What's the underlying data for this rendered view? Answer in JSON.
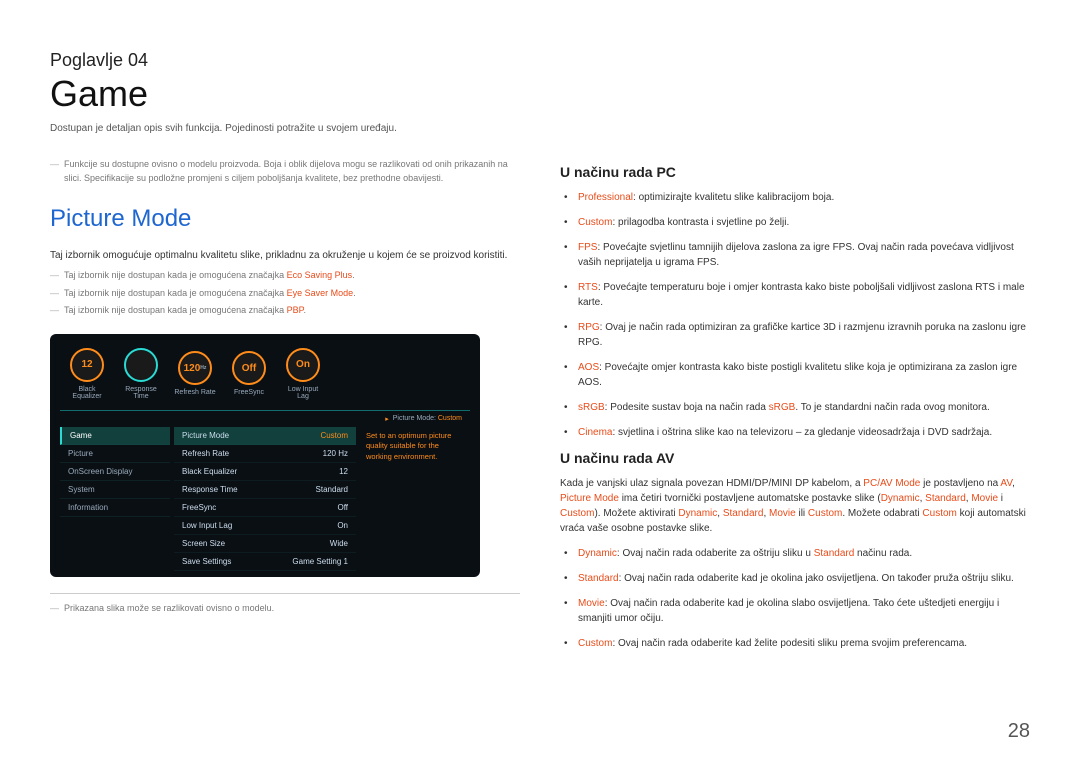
{
  "chapter": {
    "label": "Poglavlje 04",
    "title": "Game",
    "subtitle": "Dostupan je detaljan opis svih funkcija. Pojedinosti potražite u svojem uređaju."
  },
  "left": {
    "disclaimer": "Funkcije su dostupne ovisno o modelu proizvoda. Boja i oblik dijelova mogu se razlikovati od onih prikazanih na slici. Specifikacije su podložne promjeni s ciljem poboljšanja kvalitete, bez prethodne obavijesti.",
    "h2": "Picture Mode",
    "p": "Taj izbornik omogućuje optimalnu kvalitetu slike, prikladnu za okruženje u kojem će se proizvod koristiti.",
    "notes": [
      {
        "pre": "Taj izbornik nije dostupan kada je omogućena značajka ",
        "red": "Eco Saving Plus",
        "post": "."
      },
      {
        "pre": "Taj izbornik nije dostupan kada je omogućena značajka ",
        "red": "Eye Saver Mode",
        "post": "."
      },
      {
        "pre": "Taj izbornik nije dostupan kada je omogućena značajka ",
        "red": "PBP",
        "post": "."
      }
    ],
    "footnote": "Prikazana slika može se razlikovati ovisno o modelu."
  },
  "osd": {
    "dials": [
      {
        "val": "12",
        "lbl": "Black Equalizer",
        "style": "orange"
      },
      {
        "val": "",
        "lbl": "Response Time",
        "style": "cyan"
      },
      {
        "val": "120",
        "sub": "Hz",
        "lbl": "Refresh Rate",
        "style": "orange"
      },
      {
        "val": "Off",
        "lbl": "FreeSync",
        "style": "orange"
      },
      {
        "val": "On",
        "lbl": "Low Input Lag",
        "style": "orange"
      }
    ],
    "status": {
      "k": "Picture Mode:",
      "v": "Custom"
    },
    "menu": [
      "Game",
      "Picture",
      "OnScreen Display",
      "System",
      "Information"
    ],
    "menuActive": 0,
    "settings": [
      {
        "k": "Picture Mode",
        "v": "Custom",
        "active": true,
        "red": true
      },
      {
        "k": "Refresh Rate",
        "v": "120 Hz"
      },
      {
        "k": "Black Equalizer",
        "v": "12"
      },
      {
        "k": "Response Time",
        "v": "Standard"
      },
      {
        "k": "FreeSync",
        "v": "Off"
      },
      {
        "k": "Low Input Lag",
        "v": "On"
      },
      {
        "k": "Screen Size",
        "v": "Wide"
      },
      {
        "k": "Save Settings",
        "v": "Game Setting 1"
      }
    ],
    "desc": "Set to an optimum picture quality suitable for the working environment."
  },
  "right": {
    "pc": {
      "h": "U načinu rada PC",
      "items": [
        {
          "segs": [
            {
              "t": "Professional",
              "c": "red"
            },
            {
              "t": ": optimizirajte kvalitetu slike kalibracijom boja."
            }
          ]
        },
        {
          "segs": [
            {
              "t": "Custom",
              "c": "red"
            },
            {
              "t": ": prilagodba kontrasta i svjetline po želji."
            }
          ]
        },
        {
          "segs": [
            {
              "t": "FPS",
              "c": "red"
            },
            {
              "t": ": Povećajte svjetlinu tamnijih dijelova zaslona za igre FPS. Ovaj način rada povećava vidljivost vaših neprijatelja u igrama FPS."
            }
          ]
        },
        {
          "segs": [
            {
              "t": "RTS",
              "c": "red"
            },
            {
              "t": ": Povećajte temperaturu boje i omjer kontrasta kako biste poboljšali vidljivost zaslona RTS i male karte."
            }
          ]
        },
        {
          "segs": [
            {
              "t": "RPG",
              "c": "red"
            },
            {
              "t": ": Ovaj je način rada optimiziran za grafičke kartice 3D i razmjenu izravnih poruka na zaslonu igre RPG."
            }
          ]
        },
        {
          "segs": [
            {
              "t": "AOS",
              "c": "red"
            },
            {
              "t": ": Povećajte omjer kontrasta kako biste postigli kvalitetu slike koja je optimizirana za zaslon igre AOS."
            }
          ]
        },
        {
          "segs": [
            {
              "t": "sRGB",
              "c": "red"
            },
            {
              "t": ": Podesite sustav boja na način rada "
            },
            {
              "t": "sRGB",
              "c": "red"
            },
            {
              "t": ". To je standardni način rada ovog monitora."
            }
          ]
        },
        {
          "segs": [
            {
              "t": "Cinema",
              "c": "red"
            },
            {
              "t": ": svjetlina i oštrina slike kao na televizoru – za gledanje videosadržaja i DVD sadržaja."
            }
          ]
        }
      ]
    },
    "av": {
      "h": "U načinu rada AV",
      "intro_segs": [
        {
          "t": "Kada je vanjski ulaz signala povezan HDMI/DP/MINI DP kabelom, a "
        },
        {
          "t": "PC/AV Mode",
          "c": "red"
        },
        {
          "t": " je postavljeno na "
        },
        {
          "t": "AV",
          "c": "red"
        },
        {
          "t": ", "
        },
        {
          "t": "Picture Mode",
          "c": "red"
        },
        {
          "t": " ima četiri tvornički postavljene automatske postavke slike ("
        },
        {
          "t": "Dynamic",
          "c": "red"
        },
        {
          "t": ", "
        },
        {
          "t": "Standard",
          "c": "red"
        },
        {
          "t": ", "
        },
        {
          "t": "Movie",
          "c": "red"
        },
        {
          "t": " i "
        },
        {
          "t": "Custom",
          "c": "red"
        },
        {
          "t": "). Možete aktivirati "
        },
        {
          "t": "Dynamic",
          "c": "red"
        },
        {
          "t": ", "
        },
        {
          "t": "Standard",
          "c": "red"
        },
        {
          "t": ", "
        },
        {
          "t": "Movie",
          "c": "red"
        },
        {
          "t": " ili "
        },
        {
          "t": "Custom",
          "c": "red"
        },
        {
          "t": ". Možete odabrati "
        },
        {
          "t": "Custom",
          "c": "red"
        },
        {
          "t": " koji automatski vraća vaše osobne postavke slike."
        }
      ],
      "items": [
        {
          "segs": [
            {
              "t": "Dynamic",
              "c": "red"
            },
            {
              "t": ": Ovaj način rada odaberite za oštriju sliku u "
            },
            {
              "t": "Standard",
              "c": "red"
            },
            {
              "t": " načinu rada."
            }
          ]
        },
        {
          "segs": [
            {
              "t": "Standard",
              "c": "red"
            },
            {
              "t": ": Ovaj način rada odaberite kad je okolina jako osvijetljena. On također pruža oštriju sliku."
            }
          ]
        },
        {
          "segs": [
            {
              "t": "Movie",
              "c": "red"
            },
            {
              "t": ": Ovaj način rada odaberite kad je okolina slabo osvijetljena. Tako ćete uštedjeti energiju i smanjiti umor očiju."
            }
          ]
        },
        {
          "segs": [
            {
              "t": "Custom",
              "c": "red"
            },
            {
              "t": ": Ovaj način rada odaberite kad želite podesiti sliku prema svojim preferencama."
            }
          ]
        }
      ]
    }
  },
  "pageNumber": "28"
}
